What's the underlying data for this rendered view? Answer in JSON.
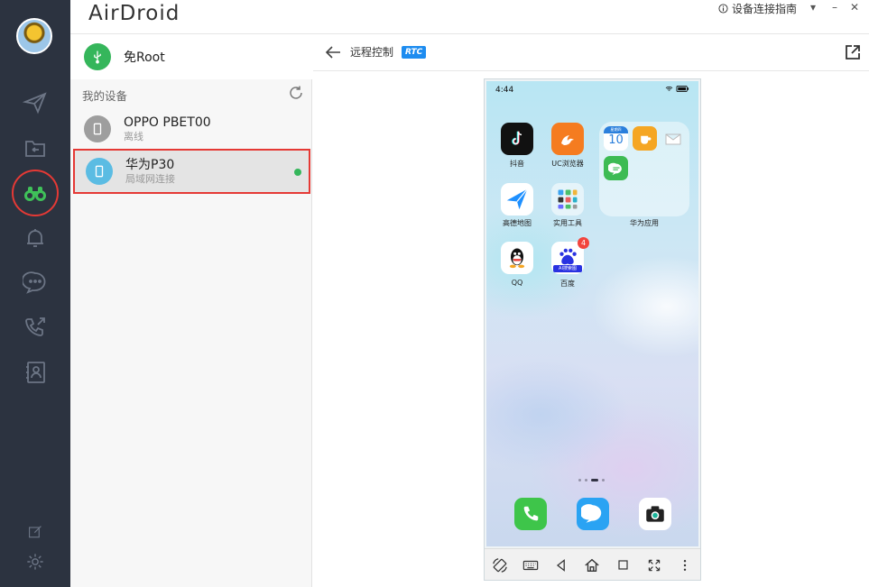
{
  "app": {
    "logo": "AirDroid"
  },
  "titlebar": {
    "guide_label": "设备连接指南",
    "minimize": "–",
    "close": "✕",
    "dropdown": "▾"
  },
  "device_panel": {
    "root_label": "免Root",
    "section_title": "我的设备",
    "devices": [
      {
        "name": "OPPO PBET00",
        "status": "离线",
        "color": "#9e9e9e"
      },
      {
        "name": "华为P30",
        "status": "局域网连接",
        "color": "#5bbce3"
      }
    ]
  },
  "remote": {
    "title": "远程控制",
    "badge": "RTC"
  },
  "phone": {
    "time": "4:44",
    "apps": [
      {
        "label": "抖音"
      },
      {
        "label": "UC浏览器"
      },
      {
        "label": "高德地图"
      },
      {
        "label": "实用工具"
      },
      {
        "label": "QQ"
      },
      {
        "label": "百度",
        "badge": "4"
      }
    ],
    "folder_label": "华为应用",
    "calendar_day": "10",
    "calendar_weekday": "星期四",
    "baidu_sub": "AI搜索图"
  },
  "colors": {
    "nav_bg": "#2c3340",
    "accent_green": "#35b65b",
    "highlight_red": "#e53935",
    "rtc_blue": "#1d8cf0"
  }
}
